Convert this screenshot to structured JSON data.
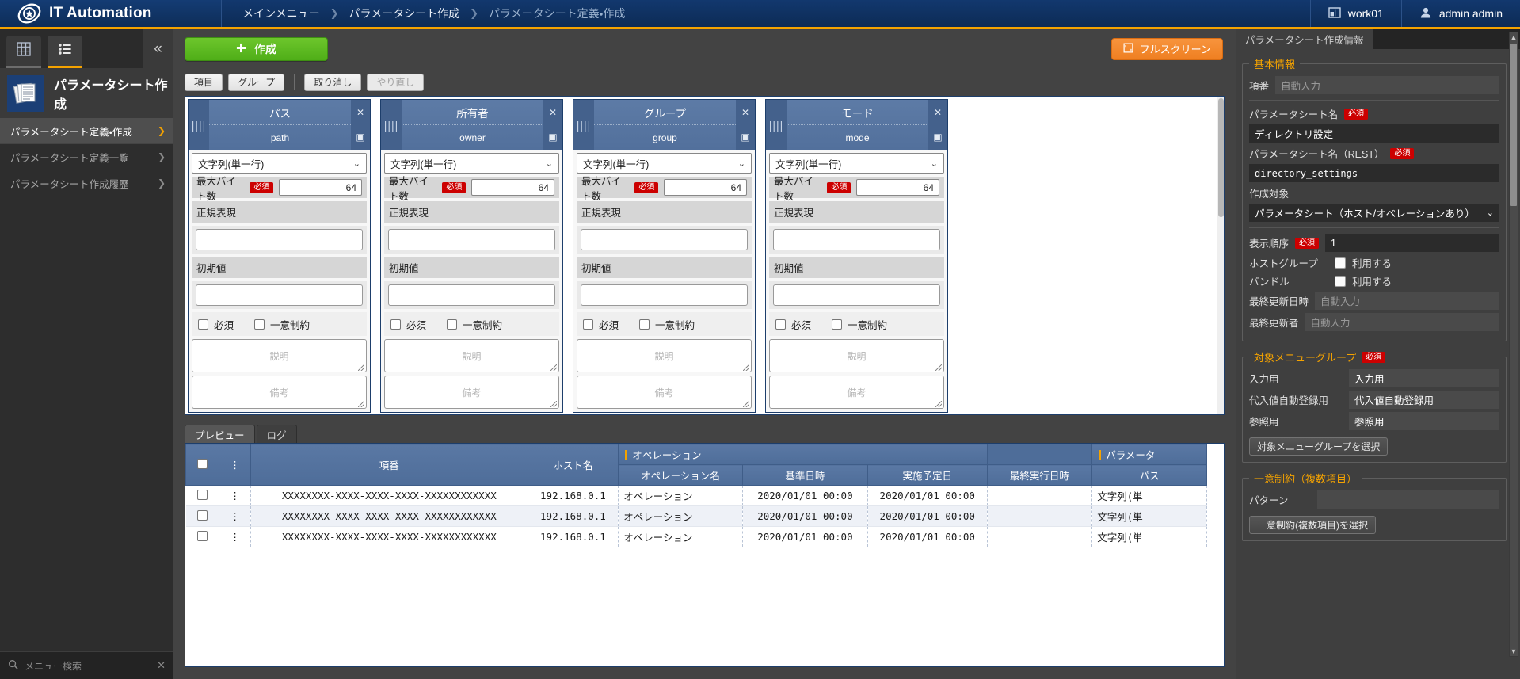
{
  "app": {
    "brand": "IT Automation",
    "logo_icon": "ita-logo-icon"
  },
  "breadcrumb": {
    "items": [
      "メインメニュー",
      "パラメータシート作成",
      "パラメータシート定義・作成"
    ],
    "separator": "❯"
  },
  "topbar": {
    "workspace_icon": "workspace-icon",
    "workspace": "work01",
    "user_icon": "user-avatar-icon",
    "user": "admin admin"
  },
  "sidebar": {
    "tab_grid_icon": "grid-menu-icon",
    "tab_list_icon": "list-menu-icon",
    "collapse_icon": "«",
    "title_icon": "parameter-sheet-icon",
    "title": "パラメータシート作成",
    "items": [
      {
        "label": "パラメータシート定義・作成",
        "active": true
      },
      {
        "label": "パラメータシート定義一覧",
        "active": false
      },
      {
        "label": "パラメータシート作成履歴",
        "active": false
      }
    ],
    "search_icon": "search-icon",
    "search_placeholder": "メニュー検索",
    "search_clear_icon": "✕"
  },
  "toolbar": {
    "create_icon": "plus-icon",
    "create_label": "作成",
    "fullscreen_icon": "fullscreen-icon",
    "fullscreen_label": "フルスクリーン",
    "buttons": [
      {
        "label": "項目",
        "disabled": false
      },
      {
        "label": "グループ",
        "disabled": false
      },
      {
        "label": "取り消し",
        "disabled": false
      },
      {
        "label": "やり直し",
        "disabled": true
      }
    ]
  },
  "cards": [
    {
      "title": "パス",
      "rest_name": "path",
      "close_icon": "✕",
      "copy_icon": "▣",
      "grip_icon": "||||",
      "type_value": "文字列(単一行)",
      "maxbyte_label": "最大バイト数",
      "maxbyte_badge": "必須",
      "maxbyte_value": "64",
      "regex_label": "正規表現",
      "regex_value": "",
      "default_label": "初期値",
      "default_value": "",
      "chk_required": "必須",
      "chk_unique": "一意制約",
      "desc_placeholder": "説明",
      "note_placeholder": "備考"
    },
    {
      "title": "所有者",
      "rest_name": "owner",
      "close_icon": "✕",
      "copy_icon": "▣",
      "grip_icon": "||||",
      "type_value": "文字列(単一行)",
      "maxbyte_label": "最大バイト数",
      "maxbyte_badge": "必須",
      "maxbyte_value": "64",
      "regex_label": "正規表現",
      "regex_value": "",
      "default_label": "初期値",
      "default_value": "",
      "chk_required": "必須",
      "chk_unique": "一意制約",
      "desc_placeholder": "説明",
      "note_placeholder": "備考"
    },
    {
      "title": "グループ",
      "rest_name": "group",
      "close_icon": "✕",
      "copy_icon": "▣",
      "grip_icon": "||||",
      "type_value": "文字列(単一行)",
      "maxbyte_label": "最大バイト数",
      "maxbyte_badge": "必須",
      "maxbyte_value": "64",
      "regex_label": "正規表現",
      "regex_value": "",
      "default_label": "初期値",
      "default_value": "",
      "chk_required": "必須",
      "chk_unique": "一意制約",
      "desc_placeholder": "説明",
      "note_placeholder": "備考"
    },
    {
      "title": "モード",
      "rest_name": "mode",
      "close_icon": "✕",
      "copy_icon": "▣",
      "grip_icon": "||||",
      "type_value": "文字列(単一行)",
      "maxbyte_label": "最大バイト数",
      "maxbyte_badge": "必須",
      "maxbyte_value": "64",
      "regex_label": "正規表現",
      "regex_value": "",
      "default_label": "初期値",
      "default_value": "",
      "chk_required": "必須",
      "chk_unique": "一意制約",
      "desc_placeholder": "説明",
      "note_placeholder": "備考"
    }
  ],
  "preview": {
    "tabs": [
      {
        "label": "プレビュー",
        "active": true
      },
      {
        "label": "ログ",
        "active": false
      }
    ],
    "group_headers": [
      {
        "label": "オペレーション",
        "span": 3
      },
      {
        "label": "パラメータ",
        "span": 1
      }
    ],
    "columns": [
      "項番",
      "ホスト名",
      "オペレーション名",
      "基準日時",
      "実施予定日",
      "最終実行日時",
      "パス"
    ],
    "rows": [
      {
        "id": "XXXXXXXX-XXXX-XXXX-XXXX-XXXXXXXXXXXX",
        "host": "192.168.0.1",
        "operation": "オペレーション",
        "base_date": "2020/01/01 00:00",
        "scheduled_date": "2020/01/01 00:00",
        "last_run": "",
        "path": "文字列(単"
      },
      {
        "id": "XXXXXXXX-XXXX-XXXX-XXXX-XXXXXXXXXXXX",
        "host": "192.168.0.1",
        "operation": "オペレーション",
        "base_date": "2020/01/01 00:00",
        "scheduled_date": "2020/01/01 00:00",
        "last_run": "",
        "path": "文字列(単"
      },
      {
        "id": "XXXXXXXX-XXXX-XXXX-XXXX-XXXXXXXXXXXX",
        "host": "192.168.0.1",
        "operation": "オペレーション",
        "base_date": "2020/01/01 00:00",
        "scheduled_date": "2020/01/01 00:00",
        "last_run": "",
        "path": "文字列(単"
      }
    ],
    "menu_icon": "kebab-menu-icon",
    "select_all_icon": "checkbox-icon"
  },
  "rightpanel": {
    "tab_label": "パラメータシート作成情報",
    "basic": {
      "legend": "基本情報",
      "no_label": "項番",
      "no_placeholder": "自動入力",
      "sheet_name_label": "パラメータシート名",
      "sheet_name_badge": "必須",
      "sheet_name_value": "ディレクトリ設定",
      "sheet_rest_label": "パラメータシート名（REST）",
      "sheet_rest_badge": "必須",
      "sheet_rest_value": "directory_settings",
      "target_label": "作成対象",
      "target_value": "パラメータシート（ホスト/オペレーションあり）",
      "order_label": "表示順序",
      "order_badge": "必須",
      "order_value": "1",
      "hostgroup_label": "ホストグループ",
      "hostgroup_check_label": "利用する",
      "bundle_label": "バンドル",
      "bundle_check_label": "利用する",
      "last_update_label": "最終更新日時",
      "last_update_placeholder": "自動入力",
      "last_updater_label": "最終更新者",
      "last_updater_placeholder": "自動入力"
    },
    "menu_group": {
      "legend": "対象メニューグループ",
      "badge": "必須",
      "input_label": "入力用",
      "input_value": "入力用",
      "auto_label": "代入値自動登録用",
      "auto_value": "代入値自動登録用",
      "ref_label": "参照用",
      "ref_value": "参照用",
      "select_button": "対象メニューグループを選択"
    },
    "unique": {
      "legend": "一意制約（複数項目）",
      "pattern_label": "パターン",
      "pattern_value": "",
      "select_button": "一意制約(複数項目)を選択"
    },
    "scroll_up_icon": "▲",
    "scroll_down_icon": "▼"
  },
  "colors": {
    "brand_blue": "#12386e",
    "accent_orange": "#f5a300",
    "create_green": "#4fae18",
    "required_red": "#cc0000",
    "card_header_blue": "#52709c"
  }
}
